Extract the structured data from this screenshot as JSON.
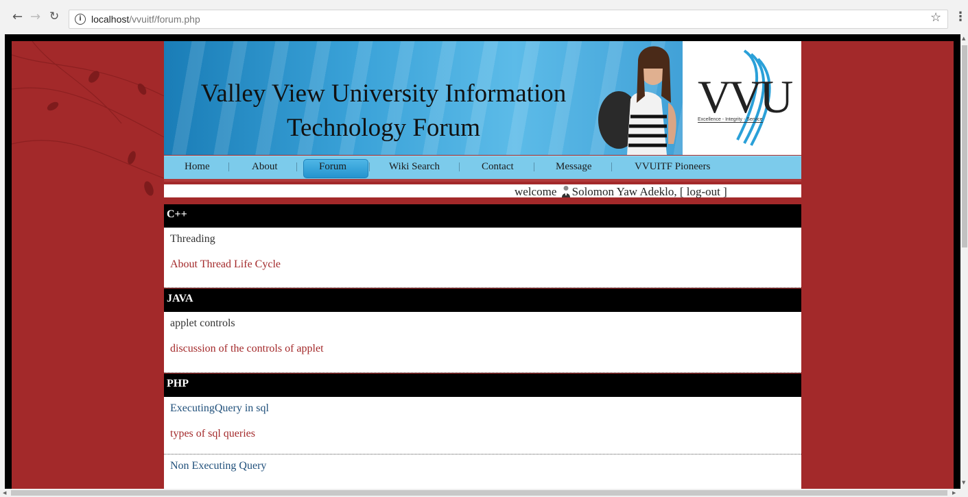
{
  "browser": {
    "url_host": "localhost",
    "url_path": "/vvuitf/forum.php",
    "icons": [
      "back-arrow-icon",
      "forward-arrow-icon",
      "reload-icon",
      "info-icon",
      "star-icon",
      "menu-icon"
    ]
  },
  "banner": {
    "title_line1": "Valley View University Information",
    "title_line2": "Technology Forum",
    "logo_text": "VVU",
    "logo_tagline": "Excellence - Integrity - Service"
  },
  "menu": {
    "items": [
      "Home",
      "About",
      "Forum",
      "Wiki Search",
      "Contact",
      "Message",
      "VVUITF Pioneers"
    ],
    "active": "Forum",
    "separator": "|"
  },
  "welcome": {
    "prefix": "welcome",
    "user": "Solomon Yaw Adeklo,",
    "logout": "[ log-out ]"
  },
  "sections": [
    {
      "heading": "C++",
      "topics": [
        {
          "title": "Threading",
          "desc": "About Thread Life Cycle"
        }
      ]
    },
    {
      "heading": "JAVA",
      "topics": [
        {
          "title": "applet controls",
          "desc": "discussion of the controls of applet"
        }
      ]
    },
    {
      "heading": "PHP",
      "topics": [
        {
          "title": "ExecutingQuery in sql",
          "desc": "types of sql queries"
        },
        {
          "title": "Non Executing Query",
          "desc": ""
        }
      ]
    }
  ],
  "colors": {
    "page_bg": "#a3292a",
    "menubar": "#7ccbeb",
    "heading_bg": "#000000",
    "link_red": "#a3292a",
    "link_blue": "#1f4f7a"
  }
}
